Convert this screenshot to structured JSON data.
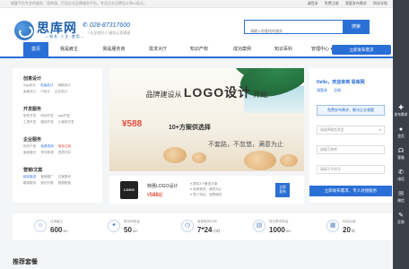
{
  "topbar": {
    "intro": "威客平台专业的服务：思库网，打造企业品牌服务平台，专业企业品牌设计和VI设计。",
    "links": [
      "请登录",
      "免费注册",
      "我要发布需求",
      "网站导航"
    ]
  },
  "header": {
    "logo_text": "思库网",
    "logo_sub": "—知名·人文·使用—",
    "phone": "028-87317600",
    "phone_sub": "7天全程好人 服务让您满意"
  },
  "search": {
    "placeholder": "请输入你要找的服务",
    "button": "搜索"
  },
  "nav": {
    "items": [
      "首页",
      "我是雇主",
      "我是服务商",
      "需求大厅",
      "知识产权",
      "成功案例",
      "知识百科",
      "管理中心"
    ],
    "cta": "立即发布需求"
  },
  "categories": [
    {
      "title": "创意设计",
      "rows": [
        [
          "logo设计",
          "包装设计",
          "海报设计"
        ],
        [
          "画册设计",
          "VI设计",
          "企业设计"
        ]
      ]
    },
    {
      "title": "开发服务",
      "rows": [
        [
          "软件开发",
          "网站开发",
          "app开发"
        ],
        [
          "工具开发",
          "微信开发",
          "小程序开发"
        ]
      ]
    },
    {
      "title": "企业服务",
      "rows": [
        [
          "知识产权",
          "免费咨询",
          "商标注册"
        ],
        [
          "版权登记",
          "专利申请",
          "资质代办"
        ]
      ]
    },
    {
      "title": "营销/文案",
      "rows": [
        [
          "起名取名",
          "营销推广",
          "文案策划"
        ],
        [
          "翻译服务",
          "知识付费",
          "视频配音"
        ]
      ]
    }
  ],
  "banner": {
    "line_prefix": "品牌建设从",
    "line_big": "LOGO设计",
    "line_suffix": "开始",
    "price": "¥588",
    "plan": "10+方案供选择",
    "slogan": "不套路，不忽悠，满意为止"
  },
  "product": {
    "thumb": "LOGO",
    "name": "特惠LOGO设计",
    "price_value": "588",
    "price_prefix": "¥",
    "price_suffix": "起",
    "features": [
      "提供3个备选方案",
      "免费修改，满意为止",
      "签订协议，保障服务"
    ],
    "button_line1": "立即",
    "button_line2": "发布"
  },
  "panel": {
    "hello": "Hello，欢迎来到 思库网",
    "links": [
      "请登录",
      "注册"
    ],
    "free_btn": "免费发布需求，解决企业难题",
    "selects": [
      "请选择服务类型",
      "请填写称呼",
      "请填写手机号"
    ],
    "submit": "立即发布需求，专人对接服务"
  },
  "stats": [
    {
      "icon": "person-icon",
      "glyph": "☺",
      "label": "注册雇主",
      "value": "600",
      "unit": "W+"
    },
    {
      "icon": "team-icon",
      "glyph": "✦",
      "label": "服务商数量",
      "value": "50",
      "unit": "W+"
    },
    {
      "icon": "clock-icon",
      "glyph": "◷",
      "label": "客服服务时间",
      "value": "7*24",
      "unit": "小时"
    },
    {
      "icon": "document-icon",
      "glyph": "▤",
      "label": "提交需求数量",
      "value": "1000",
      "unit": "W+"
    },
    {
      "icon": "calendar-icon",
      "glyph": "▦",
      "label": "网站运营",
      "value": "20",
      "unit": "年"
    }
  ],
  "section_title": "推荐套餐",
  "sidebar": [
    {
      "icon": "plus-icon",
      "glyph": "✚",
      "label": "发布需求"
    },
    {
      "icon": "user-icon",
      "glyph": "●",
      "label": "会员"
    },
    {
      "icon": "headset-icon",
      "glyph": "☊",
      "label": "客服"
    },
    {
      "icon": "phone-icon",
      "glyph": "✆",
      "label": "电话"
    },
    {
      "icon": "wechat-icon",
      "glyph": "✉",
      "label": "微信"
    },
    {
      "icon": "feedback-icon",
      "glyph": "✎",
      "label": "反馈"
    }
  ],
  "colors": {
    "primary": "#2a6fd6",
    "price": "#e74c3c",
    "sidebar": "#3a3f48"
  }
}
